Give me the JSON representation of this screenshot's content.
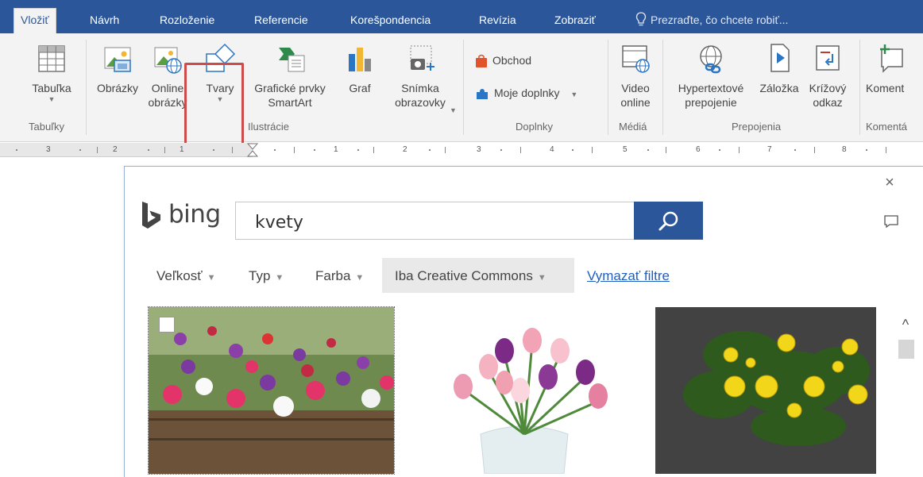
{
  "tabs": [
    {
      "label": "Vložiť",
      "active": true
    },
    {
      "label": "Návrh"
    },
    {
      "label": "Rozloženie"
    },
    {
      "label": "Referencie"
    },
    {
      "label": "Korešpondencia"
    },
    {
      "label": "Revízia"
    },
    {
      "label": "Zobraziť"
    }
  ],
  "tell_me": "Prezraďte, čo chcete robiť...",
  "ribbon": {
    "tables": {
      "button": "Tabuľka",
      "group": "Tabuľky"
    },
    "illustrations": {
      "pictures": "Obrázky",
      "online_pictures_line1": "Online",
      "online_pictures_line2": "obrázky",
      "shapes": "Tvary",
      "smartart_line1": "Grafické prvky",
      "smartart_line2": "SmartArt",
      "chart": "Graf",
      "screenshot_line1": "Snímka",
      "screenshot_line2": "obrazovky",
      "group": "Ilustrácie"
    },
    "addins": {
      "store": "Obchod",
      "my_addins": "Moje doplnky",
      "group": "Doplnky"
    },
    "media": {
      "video_line1": "Video",
      "video_line2": "online",
      "group": "Médiá"
    },
    "links": {
      "hyperlink_line1": "Hypertextové",
      "hyperlink_line2": "prepojenie",
      "bookmark": "Záložka",
      "crossref_line1": "Krížový",
      "crossref_line2": "odkaz",
      "group": "Prepojenia"
    },
    "comments": {
      "button": "Koment",
      "group": "Komentá"
    }
  },
  "ruler": {
    "ticks": [
      "3",
      "2",
      "1",
      "1",
      "2",
      "3",
      "4",
      "5",
      "6",
      "7",
      "8"
    ]
  },
  "dialog": {
    "logo_text": "bing",
    "search_value": "kvety",
    "filters": [
      "Veľkosť",
      "Typ",
      "Farba",
      "Iba Creative Commons"
    ],
    "clear_filters": "Vymazať filtre"
  },
  "colors": {
    "accent": "#2b579a",
    "highlight_box": "#cf4a4a",
    "link": "#1e5fc4"
  }
}
